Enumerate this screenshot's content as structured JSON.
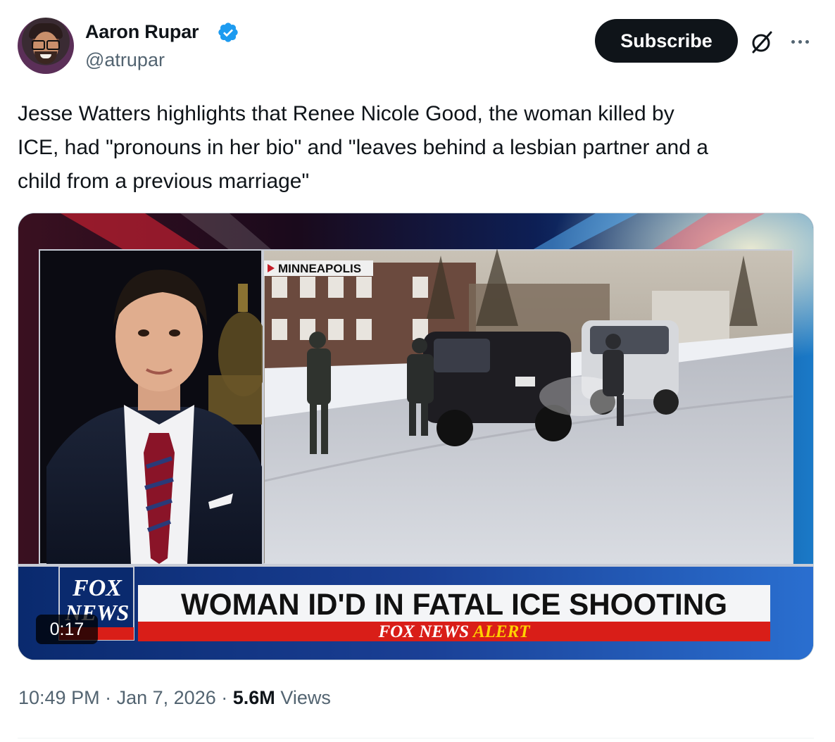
{
  "author": {
    "name": "Aaron Rupar",
    "handle": "@atrupar",
    "verified": true
  },
  "header": {
    "subscribe_label": "Subscribe",
    "grok_icon": "grok-icon",
    "more_icon": "more-options-icon"
  },
  "tweet": {
    "text": "Jesse Watters highlights that Renee Nicole Good, the woman killed by\nICE, had \"pronouns in her bio\" and \"leaves behind a lesbian partner and a\nchild from a previous marriage\""
  },
  "video": {
    "duration": "0:17",
    "location_tag": "MINNEAPOLIS",
    "chyron": "WOMAN ID'D IN FATAL ICE SHOOTING",
    "alert_brand": "FOX NEWS",
    "alert_word": "ALERT",
    "logo_top": "FOX",
    "logo_bottom": "NEWS"
  },
  "meta": {
    "time": "10:49 PM",
    "date": "Jan 7, 2026",
    "views_count": "5.6M",
    "views_label": "Views",
    "separator": "·"
  },
  "colors": {
    "accent_verified": "#1d9bf0",
    "text_primary": "#0f1419",
    "text_secondary": "#536471",
    "fox_red": "#d91e18",
    "fox_blue": "#0a2a6e"
  }
}
